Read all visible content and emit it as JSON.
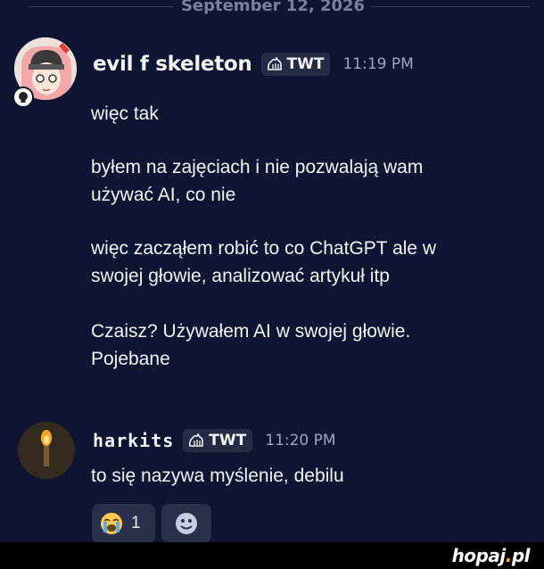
{
  "date_divider": "September 12, 2026",
  "messages": [
    {
      "username": "evil f skeleton",
      "tag": "TWT",
      "time": "11:19 PM",
      "lines": [
        "więc tak",
        "byłem na zajęciach i nie pozwalają wam",
        "używać AI, co nie",
        "więc zacząłem robić to co ChatGPT ale w",
        "swojej głowie, analizować artykuł itp",
        "Czaisz? Używałem AI w swojej głowie.",
        "Pojebane"
      ]
    },
    {
      "username": "harkits",
      "tag": "TWT",
      "time": "11:20 PM",
      "lines": [
        "to się nazywa myślenie, debilu"
      ]
    }
  ],
  "reactions": [
    {
      "emoji": "😭",
      "count": "1"
    },
    {
      "emoji": "add-reaction-icon"
    }
  ],
  "watermark": "hopaj.pl",
  "colors": {
    "background": "#101533",
    "tag_bg": "#262b45",
    "reaction_bg": "#2a2f4c"
  }
}
